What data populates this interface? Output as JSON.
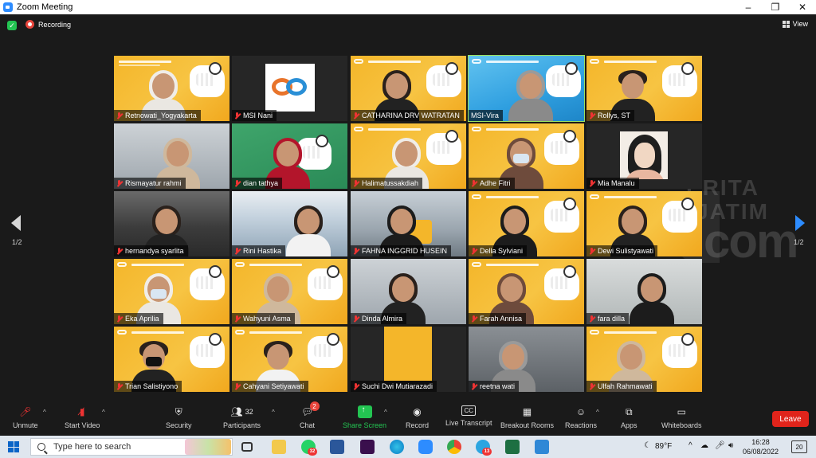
{
  "window": {
    "title": "Zoom Meeting",
    "minimize_glyph": "–",
    "maximize_glyph": "❐",
    "close_glyph": "✕"
  },
  "meeting": {
    "recording_label": "Recording",
    "view_label": "View",
    "page_left": "1/2",
    "page_right": "1/2",
    "watermark": {
      "line1": "ERITA",
      "line2": "JATIM",
      "line3": "com"
    }
  },
  "participants": [
    {
      "name": "Retnowati_Yogyakarta"
    },
    {
      "name": "MSI Nani"
    },
    {
      "name": "CATHARINA DRV WATRATAN"
    },
    {
      "name": "MSI-Vira"
    },
    {
      "name": "Rollys, ST"
    },
    {
      "name": "Rismayatur rahmi"
    },
    {
      "name": "dian tathya"
    },
    {
      "name": "Halimatussakdiah"
    },
    {
      "name": "Adhe Fitri"
    },
    {
      "name": "Mia Manalu"
    },
    {
      "name": "hernandya syarlita"
    },
    {
      "name": "Rini Hastika"
    },
    {
      "name": "FAHNA INGGRID HUSEIN"
    },
    {
      "name": "Della Sylviani"
    },
    {
      "name": "Dewi Sulistyawati"
    },
    {
      "name": "Eka Aprilia"
    },
    {
      "name": "Wahyuni Asma"
    },
    {
      "name": "Dinda Almira"
    },
    {
      "name": "Farah Annisa"
    },
    {
      "name": "fara dilla"
    },
    {
      "name": "Trian Salistiyono"
    },
    {
      "name": "Cahyani Setiyawati"
    },
    {
      "name": "Suchi Dwi Mutiarazadi"
    },
    {
      "name": "reetna wati"
    },
    {
      "name": "Ulfah Rahmawati"
    }
  ],
  "toolbar": {
    "unmute": "Unmute",
    "start_video": "Start Video",
    "security": "Security",
    "participants_label": "Participants",
    "participants_count": "32",
    "chat": "Chat",
    "chat_badge": "2",
    "share_screen": "Share Screen",
    "record": "Record",
    "live_transcript": "Live Transcript",
    "cc_label": "CC",
    "breakout_rooms": "Breakout Rooms",
    "reactions": "Reactions",
    "apps": "Apps",
    "whiteboards": "Whiteboards",
    "leave": "Leave"
  },
  "taskbar": {
    "search_placeholder": "Type here to search",
    "weather": "89°F",
    "time": "16:28",
    "date": "06/08/2022",
    "notifications": "20",
    "whatsapp_badge": "32",
    "telegram_badge": "13"
  },
  "colors": {
    "accent_green": "#23c552",
    "leave_red": "#e0241b",
    "zoom_blue": "#2d8cff",
    "active_speaker_outline": "#9be25e"
  }
}
